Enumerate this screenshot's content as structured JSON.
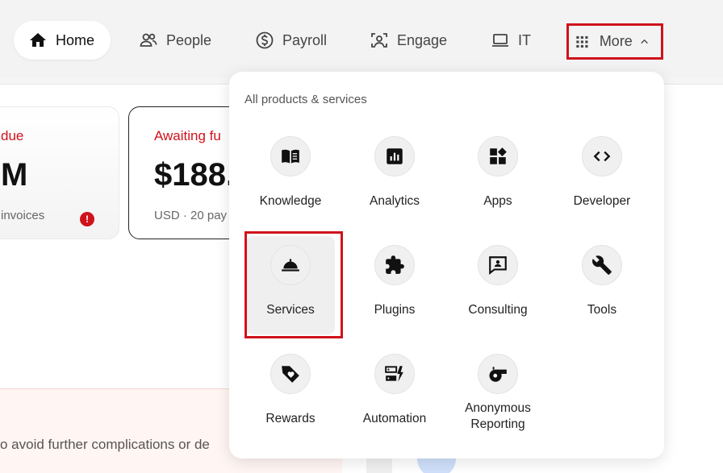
{
  "nav": {
    "home": "Home",
    "people": "People",
    "payroll": "Payroll",
    "engage": "Engage",
    "it": "IT",
    "more": "More"
  },
  "cards": [
    {
      "label": "due",
      "value": "M",
      "sub": "invoices"
    },
    {
      "label": "Awaiting fu",
      "value": "$188.",
      "sub": "USD · 20 pay"
    }
  ],
  "notice": {
    "text": "o avoid further complications or de"
  },
  "menu": {
    "title": "All products & services",
    "items": [
      {
        "label": "Knowledge",
        "icon": "book-icon"
      },
      {
        "label": "Analytics",
        "icon": "analytics-icon"
      },
      {
        "label": "Apps",
        "icon": "apps-icon"
      },
      {
        "label": "Developer",
        "icon": "code-icon"
      },
      {
        "label": "Services",
        "icon": "service-bell-icon"
      },
      {
        "label": "Plugins",
        "icon": "puzzle-icon"
      },
      {
        "label": "Consulting",
        "icon": "consulting-icon"
      },
      {
        "label": "Tools",
        "icon": "wrench-icon"
      },
      {
        "label": "Rewards",
        "icon": "rewards-tag-icon"
      },
      {
        "label": "Automation",
        "icon": "automation-icon"
      },
      {
        "label": "Anonymous Reporting",
        "icon": "whistle-icon"
      }
    ]
  },
  "colors": {
    "accent_red": "#d0121b",
    "nav_bg": "#f3f3f3"
  }
}
